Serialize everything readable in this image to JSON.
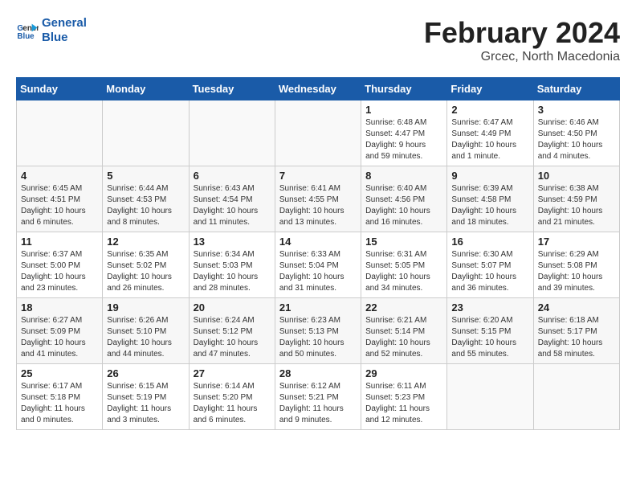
{
  "header": {
    "logo_line1": "General",
    "logo_line2": "Blue",
    "month": "February 2024",
    "location": "Grcec, North Macedonia"
  },
  "weekdays": [
    "Sunday",
    "Monday",
    "Tuesday",
    "Wednesday",
    "Thursday",
    "Friday",
    "Saturday"
  ],
  "weeks": [
    [
      {
        "day": "",
        "info": ""
      },
      {
        "day": "",
        "info": ""
      },
      {
        "day": "",
        "info": ""
      },
      {
        "day": "",
        "info": ""
      },
      {
        "day": "1",
        "info": "Sunrise: 6:48 AM\nSunset: 4:47 PM\nDaylight: 9 hours\nand 59 minutes."
      },
      {
        "day": "2",
        "info": "Sunrise: 6:47 AM\nSunset: 4:49 PM\nDaylight: 10 hours\nand 1 minute."
      },
      {
        "day": "3",
        "info": "Sunrise: 6:46 AM\nSunset: 4:50 PM\nDaylight: 10 hours\nand 4 minutes."
      }
    ],
    [
      {
        "day": "4",
        "info": "Sunrise: 6:45 AM\nSunset: 4:51 PM\nDaylight: 10 hours\nand 6 minutes."
      },
      {
        "day": "5",
        "info": "Sunrise: 6:44 AM\nSunset: 4:53 PM\nDaylight: 10 hours\nand 8 minutes."
      },
      {
        "day": "6",
        "info": "Sunrise: 6:43 AM\nSunset: 4:54 PM\nDaylight: 10 hours\nand 11 minutes."
      },
      {
        "day": "7",
        "info": "Sunrise: 6:41 AM\nSunset: 4:55 PM\nDaylight: 10 hours\nand 13 minutes."
      },
      {
        "day": "8",
        "info": "Sunrise: 6:40 AM\nSunset: 4:56 PM\nDaylight: 10 hours\nand 16 minutes."
      },
      {
        "day": "9",
        "info": "Sunrise: 6:39 AM\nSunset: 4:58 PM\nDaylight: 10 hours\nand 18 minutes."
      },
      {
        "day": "10",
        "info": "Sunrise: 6:38 AM\nSunset: 4:59 PM\nDaylight: 10 hours\nand 21 minutes."
      }
    ],
    [
      {
        "day": "11",
        "info": "Sunrise: 6:37 AM\nSunset: 5:00 PM\nDaylight: 10 hours\nand 23 minutes."
      },
      {
        "day": "12",
        "info": "Sunrise: 6:35 AM\nSunset: 5:02 PM\nDaylight: 10 hours\nand 26 minutes."
      },
      {
        "day": "13",
        "info": "Sunrise: 6:34 AM\nSunset: 5:03 PM\nDaylight: 10 hours\nand 28 minutes."
      },
      {
        "day": "14",
        "info": "Sunrise: 6:33 AM\nSunset: 5:04 PM\nDaylight: 10 hours\nand 31 minutes."
      },
      {
        "day": "15",
        "info": "Sunrise: 6:31 AM\nSunset: 5:05 PM\nDaylight: 10 hours\nand 34 minutes."
      },
      {
        "day": "16",
        "info": "Sunrise: 6:30 AM\nSunset: 5:07 PM\nDaylight: 10 hours\nand 36 minutes."
      },
      {
        "day": "17",
        "info": "Sunrise: 6:29 AM\nSunset: 5:08 PM\nDaylight: 10 hours\nand 39 minutes."
      }
    ],
    [
      {
        "day": "18",
        "info": "Sunrise: 6:27 AM\nSunset: 5:09 PM\nDaylight: 10 hours\nand 41 minutes."
      },
      {
        "day": "19",
        "info": "Sunrise: 6:26 AM\nSunset: 5:10 PM\nDaylight: 10 hours\nand 44 minutes."
      },
      {
        "day": "20",
        "info": "Sunrise: 6:24 AM\nSunset: 5:12 PM\nDaylight: 10 hours\nand 47 minutes."
      },
      {
        "day": "21",
        "info": "Sunrise: 6:23 AM\nSunset: 5:13 PM\nDaylight: 10 hours\nand 50 minutes."
      },
      {
        "day": "22",
        "info": "Sunrise: 6:21 AM\nSunset: 5:14 PM\nDaylight: 10 hours\nand 52 minutes."
      },
      {
        "day": "23",
        "info": "Sunrise: 6:20 AM\nSunset: 5:15 PM\nDaylight: 10 hours\nand 55 minutes."
      },
      {
        "day": "24",
        "info": "Sunrise: 6:18 AM\nSunset: 5:17 PM\nDaylight: 10 hours\nand 58 minutes."
      }
    ],
    [
      {
        "day": "25",
        "info": "Sunrise: 6:17 AM\nSunset: 5:18 PM\nDaylight: 11 hours\nand 0 minutes."
      },
      {
        "day": "26",
        "info": "Sunrise: 6:15 AM\nSunset: 5:19 PM\nDaylight: 11 hours\nand 3 minutes."
      },
      {
        "day": "27",
        "info": "Sunrise: 6:14 AM\nSunset: 5:20 PM\nDaylight: 11 hours\nand 6 minutes."
      },
      {
        "day": "28",
        "info": "Sunrise: 6:12 AM\nSunset: 5:21 PM\nDaylight: 11 hours\nand 9 minutes."
      },
      {
        "day": "29",
        "info": "Sunrise: 6:11 AM\nSunset: 5:23 PM\nDaylight: 11 hours\nand 12 minutes."
      },
      {
        "day": "",
        "info": ""
      },
      {
        "day": "",
        "info": ""
      }
    ]
  ]
}
